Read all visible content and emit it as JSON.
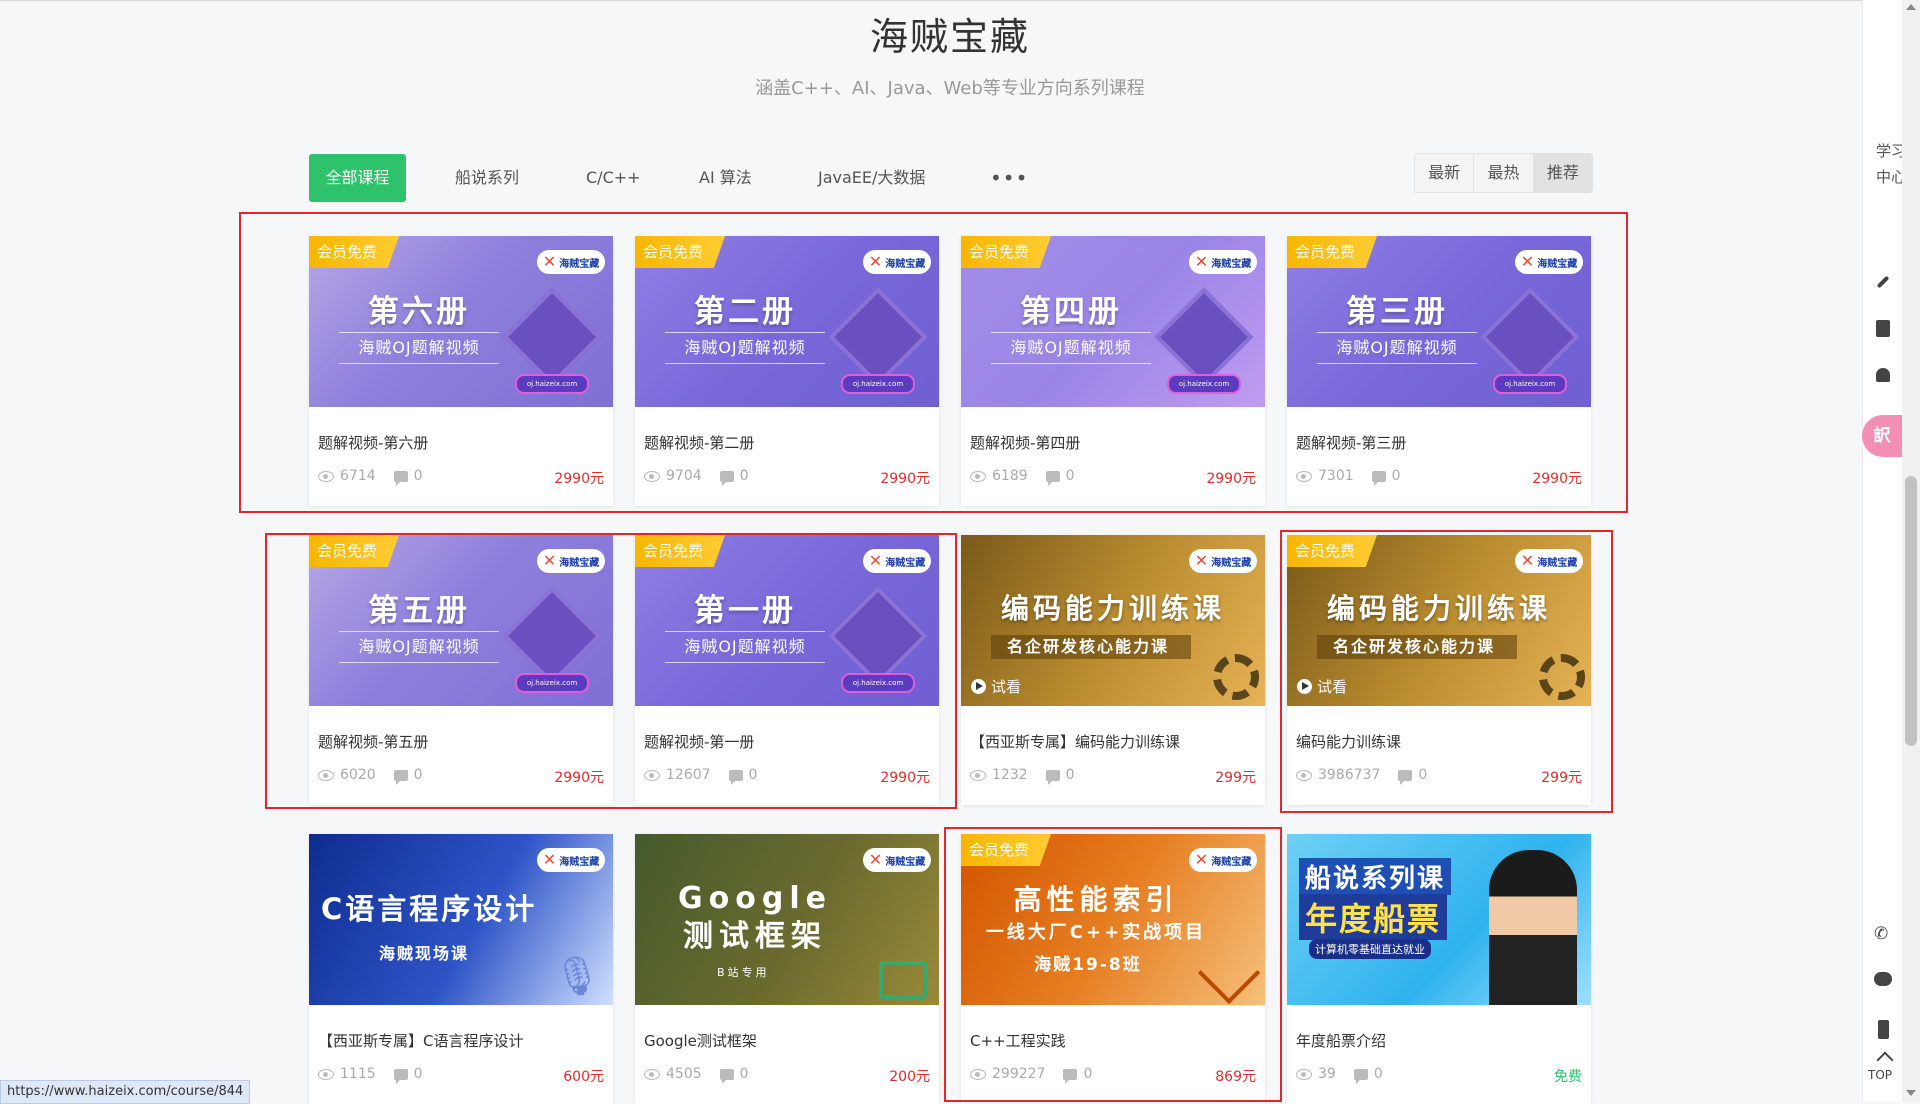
{
  "header": {
    "title": "海贼宝藏",
    "subtitle": "涵盖C++、AI、Java、Web等专业方向系列课程"
  },
  "categories": [
    {
      "label": "全部课程"
    },
    {
      "label": "船说系列"
    },
    {
      "label": "C/C++"
    },
    {
      "label": "AI 算法"
    },
    {
      "label": "JavaEE/大数据"
    },
    {
      "label": "•••"
    }
  ],
  "sort": [
    "最新",
    "最热",
    "推荐"
  ],
  "thumb_text": {
    "member_free": "会员免费",
    "oj_subtitle": "海贼OJ题解视频",
    "oj_url": "oj.haizeix.com",
    "brand": "海贼宝藏",
    "coding_title": "编码能力训练课",
    "coding_sub": "名企研发核心能力课",
    "trial": "试看",
    "c_title": "C语言程序设计",
    "c_sub": "海贼现场课",
    "g_title_1": "Google",
    "g_title_2": "测试框架",
    "g_sub": "B站专用",
    "o_title": "高性能索引",
    "o_sub": "一线大厂C++实战项目",
    "o_sub2": "海贼19-8班",
    "s_title": "船说系列课",
    "s_title2": "年度船票",
    "s_sub": "计算机零基础直达就业"
  },
  "courses": [
    {
      "cover_title": "第六册",
      "title": "题解视频-第六册",
      "views": "6714",
      "comments": "0",
      "price": "2990元"
    },
    {
      "cover_title": "第二册",
      "title": "题解视频-第二册",
      "views": "9704",
      "comments": "0",
      "price": "2990元"
    },
    {
      "cover_title": "第四册",
      "title": "题解视频-第四册",
      "views": "6189",
      "comments": "0",
      "price": "2990元"
    },
    {
      "cover_title": "第三册",
      "title": "题解视频-第三册",
      "views": "7301",
      "comments": "0",
      "price": "2990元"
    },
    {
      "cover_title": "第五册",
      "title": "题解视频-第五册",
      "views": "6020",
      "comments": "0",
      "price": "2990元"
    },
    {
      "cover_title": "第一册",
      "title": "题解视频-第一册",
      "views": "12607",
      "comments": "0",
      "price": "2990元"
    },
    {
      "title": "【西亚斯专属】编码能力训练课",
      "views": "1232",
      "comments": "0",
      "price": "299元"
    },
    {
      "title": "编码能力训练课",
      "views": "3986737",
      "comments": "0",
      "price": "299元"
    },
    {
      "title": "【西亚斯专属】C语言程序设计",
      "views": "1115",
      "comments": "0",
      "price": "600元"
    },
    {
      "title": "Google测试框架",
      "views": "4505",
      "comments": "0",
      "price": "200元"
    },
    {
      "title": "C++工程实践",
      "views": "299227",
      "comments": "0",
      "price": "869元"
    },
    {
      "title": "年度船票介绍",
      "views": "39",
      "comments": "0",
      "price": "免费"
    }
  ],
  "sidebar": {
    "study_center": "学习中心",
    "translate": "訳",
    "top": "TOP"
  },
  "status_url": "https://www.haizeix.com/course/844",
  "colors": {
    "accent": "#2dc26b",
    "price": "#e02d2d",
    "highlight": "#e3262b",
    "badge": "#f7b500"
  }
}
